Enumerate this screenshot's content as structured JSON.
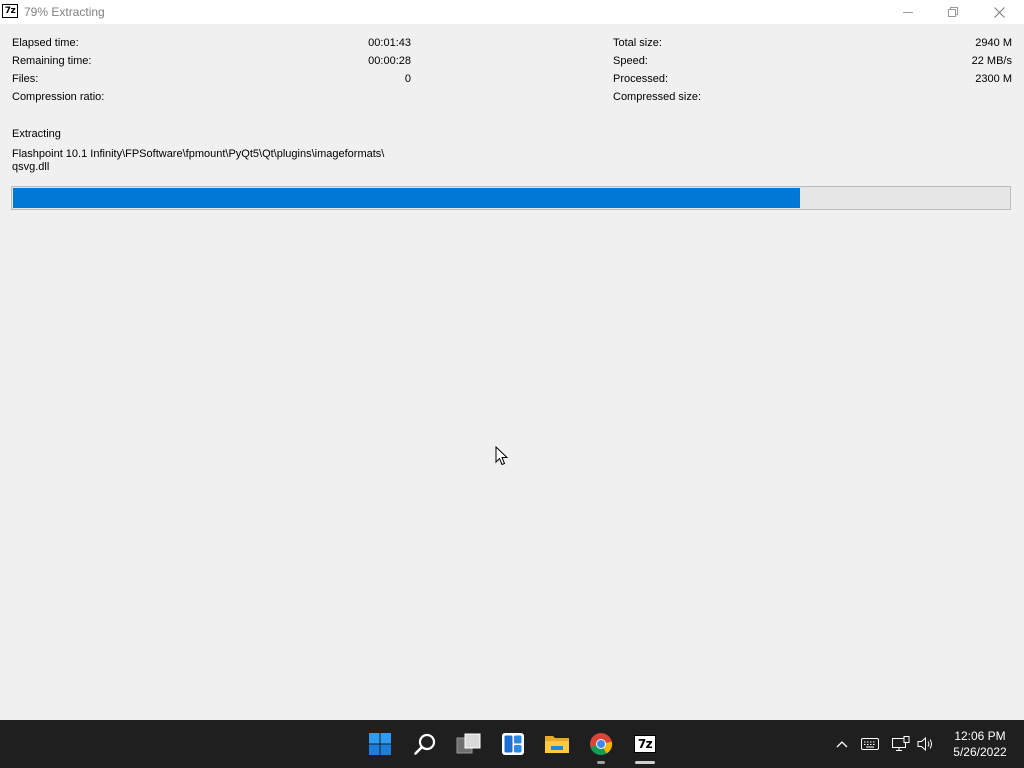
{
  "window": {
    "title": "79% Extracting",
    "app_icon_text": "7z"
  },
  "stats_left": [
    {
      "label": "Elapsed time:",
      "value": "00:01:43"
    },
    {
      "label": "Remaining time:",
      "value": "00:00:28"
    },
    {
      "label": "Files:",
      "value": "0"
    },
    {
      "label": "Compression ratio:",
      "value": ""
    }
  ],
  "stats_right": [
    {
      "label": "Total size:",
      "value": "2940 M"
    },
    {
      "label": "Speed:",
      "value": "22 MB/s"
    },
    {
      "label": "Processed:",
      "value": "2300 M"
    },
    {
      "label": "Compressed size:",
      "value": ""
    }
  ],
  "operation": {
    "label": "Extracting",
    "path_line1": "Flashpoint 10.1 Infinity\\FPSoftware\\fpmount\\PyQt5\\Qt\\plugins\\imageformats\\",
    "path_line2": "qsvg.dll"
  },
  "progress": {
    "percent": 79,
    "color": "#0078d7"
  },
  "taskbar": {
    "items": [
      "start-icon",
      "search-icon",
      "task-view-icon",
      "widgets-icon",
      "file-explorer-icon",
      "chrome-icon",
      "7zip-icon"
    ],
    "sevenzip_label": "7z",
    "time": "12:06 PM",
    "date": "5/26/2022"
  }
}
